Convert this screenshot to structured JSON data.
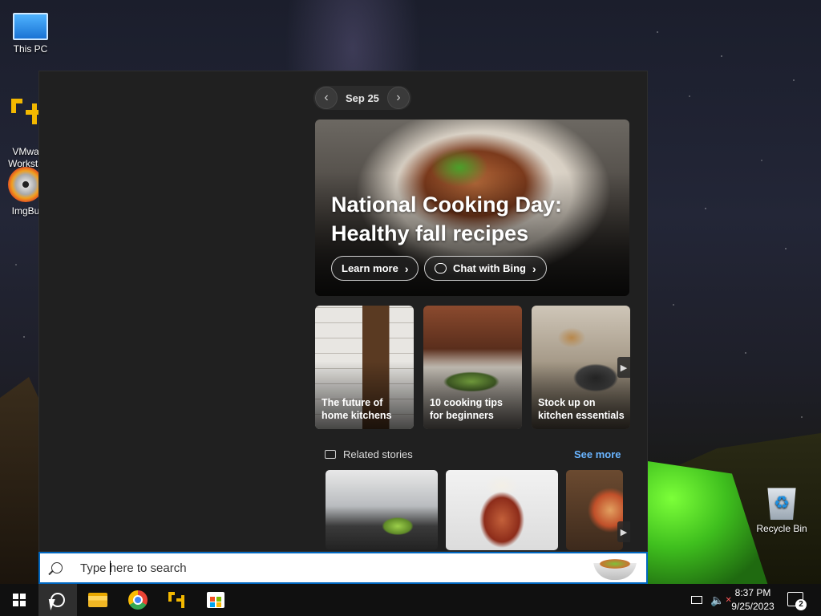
{
  "desktop": {
    "icons": [
      {
        "label": "This PC"
      },
      {
        "label": "VMwa\nWorksta"
      },
      {
        "label": "ImgBu"
      },
      {
        "label": "Recycle Bin"
      }
    ]
  },
  "panel": {
    "date": "Sep 25",
    "hero": {
      "title": "National Cooking Day: Healthy fall recipes",
      "learn_more": "Learn more",
      "chat_bing": "Chat with Bing"
    },
    "cards": [
      {
        "caption": "The future of home kitchens"
      },
      {
        "caption": "10 cooking tips for beginners"
      },
      {
        "caption": "Stock up on kitchen essentials"
      }
    ],
    "related": {
      "heading": "Related stories",
      "see_more": "See more"
    }
  },
  "search": {
    "placeholder": "Type here to search"
  },
  "taskbar": {
    "time": "8:37 PM",
    "date": "9/25/2023",
    "notification_count": "2"
  },
  "icons": {
    "prev": "chevron-left-icon",
    "next": "chevron-right-icon",
    "search": "search-icon",
    "start": "windows-logo-icon",
    "cortana": "cortana-icon"
  },
  "colors": {
    "accent": "#0067c0",
    "link": "#69b4ff",
    "panel_bg": "#202020",
    "taskbar_bg": "#101010"
  }
}
